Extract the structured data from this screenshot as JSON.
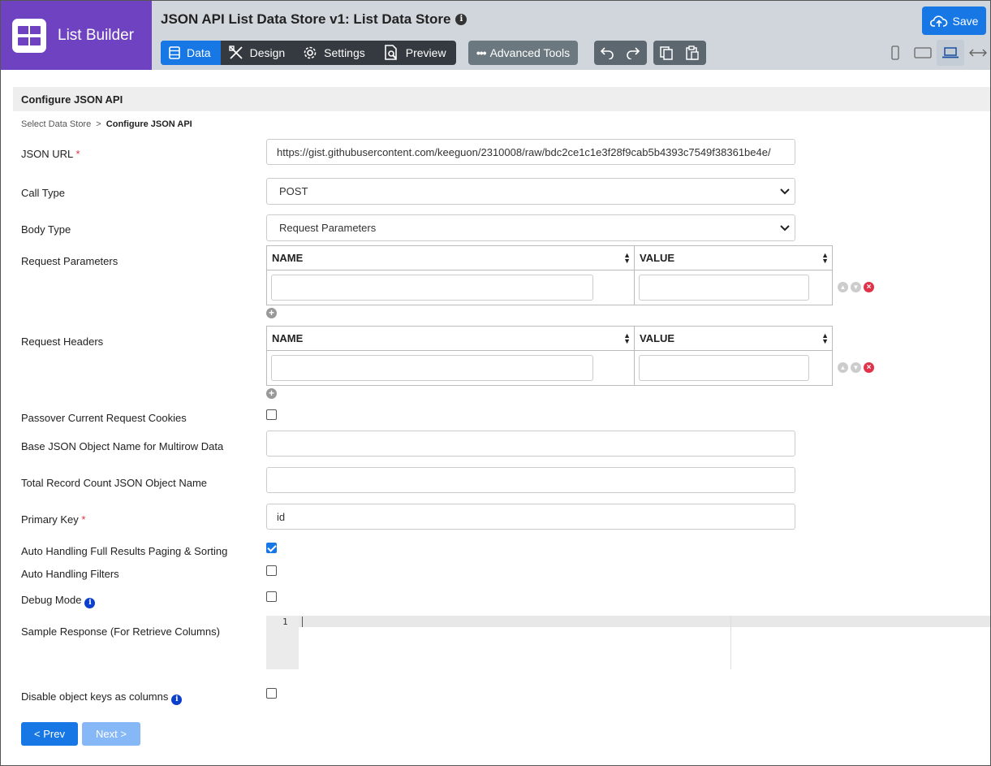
{
  "app": {
    "brand": "List Builder",
    "title": "JSON API List Data Store v1: List Data Store",
    "title_info_icon": "info-icon"
  },
  "toolbar": {
    "tabs": [
      {
        "label": "Data",
        "icon": "list-icon",
        "active": true
      },
      {
        "label": "Design",
        "icon": "design-tools-icon",
        "active": false
      },
      {
        "label": "Settings",
        "icon": "gear-icon",
        "active": false
      },
      {
        "label": "Preview",
        "icon": "preview-document-icon",
        "active": false
      }
    ],
    "advanced_tools": "Advanced Tools",
    "undo_redo": [
      "undo-icon",
      "redo-icon"
    ],
    "copy_paste": [
      "copy-icon",
      "paste-icon"
    ],
    "devices": [
      "mobile-icon",
      "tablet-icon",
      "laptop-icon",
      "full-width-icon"
    ],
    "active_device": "laptop-icon",
    "save": "Save"
  },
  "section": {
    "title": "Configure JSON API"
  },
  "breadcrumb": {
    "parent": "Select Data Store",
    "separator": ">",
    "current": "Configure JSON API"
  },
  "form": {
    "json_url": {
      "label": "JSON URL",
      "required": "*",
      "value": "https://gist.githubusercontent.com/keeguon/2310008/raw/bdc2ce1c1e3f28f9cab5b4393c7549f38361be4e/"
    },
    "call_type": {
      "label": "Call Type",
      "value": "POST"
    },
    "body_type": {
      "label": "Body Type",
      "value": "Request Parameters"
    },
    "request_parameters": {
      "label": "Request Parameters",
      "col_name": "NAME",
      "col_value": "VALUE"
    },
    "request_headers": {
      "label": "Request Headers",
      "col_name": "NAME",
      "col_value": "VALUE"
    },
    "passover_cookies": {
      "label": "Passover Current Request Cookies",
      "checked": false
    },
    "base_json_object": {
      "label": "Base JSON Object Name for Multirow Data",
      "value": ""
    },
    "total_record_count": {
      "label": "Total Record Count JSON Object Name",
      "value": ""
    },
    "primary_key": {
      "label": "Primary Key",
      "required": "*",
      "value": "id"
    },
    "auto_paging": {
      "label": "Auto Handling Full Results Paging & Sorting",
      "checked": true
    },
    "auto_filters": {
      "label": "Auto Handling Filters",
      "checked": false
    },
    "debug_mode": {
      "label": "Debug Mode",
      "checked": false
    },
    "sample_response": {
      "label": "Sample Response (For Retrieve Columns)",
      "line_number": "1"
    },
    "disable_object_keys": {
      "label": "Disable object keys as columns",
      "checked": false
    }
  },
  "nav": {
    "prev": "< Prev",
    "next": "Next >"
  },
  "colors": {
    "brand": "#6f42c1",
    "primary": "#1677e5",
    "header_bg": "#d1d6dc",
    "toolbar_dark": "#343a40",
    "danger": "#e0334a"
  }
}
